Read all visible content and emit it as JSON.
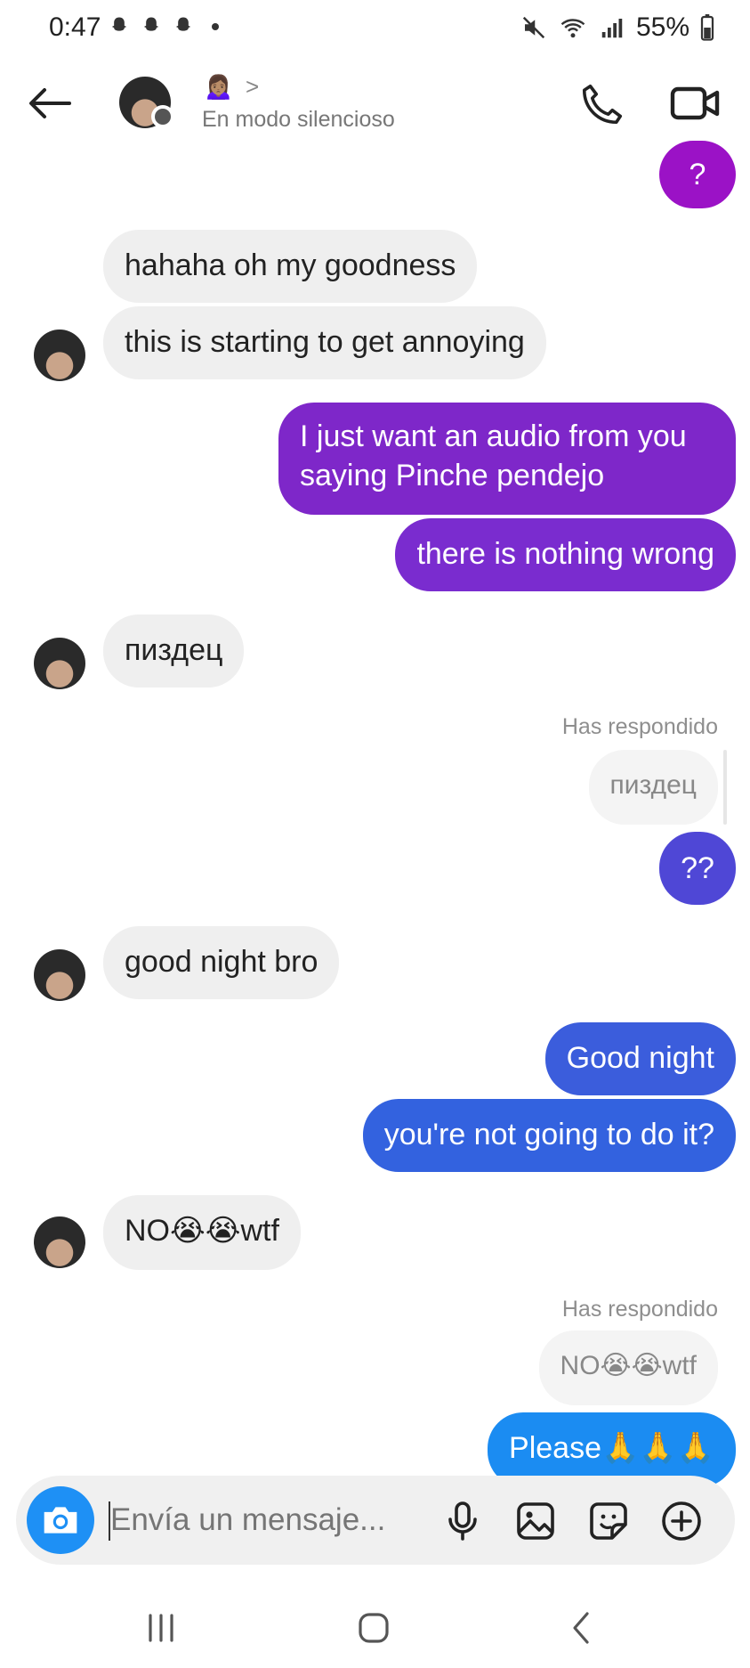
{
  "status_bar": {
    "time": "0:47",
    "battery": "55%",
    "icons": [
      "snapchat-icon",
      "snapchat-icon",
      "snapchat-icon",
      "mute-icon",
      "wifi-icon",
      "signal-icon",
      "battery-icon"
    ]
  },
  "header": {
    "contact_emoji": "🙍🏽‍♀️",
    "chevron": ">",
    "subtitle": "En modo silencioso"
  },
  "messages": [
    {
      "type": "out",
      "text": "?",
      "color": "#9b12c6"
    },
    {
      "type": "in",
      "text": "hahaha oh my goodness"
    },
    {
      "type": "in",
      "text": "this is starting to get annoying"
    },
    {
      "type": "out",
      "text": "I just want an audio from you",
      "text2": "saying Pinche pendejo",
      "color": "#7e27c9"
    },
    {
      "type": "out",
      "text": "there is nothing wrong",
      "color": "#7a2ccf"
    },
    {
      "type": "in",
      "text": "пиздец"
    },
    {
      "type": "reply_label",
      "text": "Has respondido"
    },
    {
      "type": "quoted",
      "text": "пиздец"
    },
    {
      "type": "out",
      "text": "??",
      "color": "#4f47d6"
    },
    {
      "type": "in",
      "text": "good night bro"
    },
    {
      "type": "out",
      "text": "Good night",
      "color": "#3b5ddc"
    },
    {
      "type": "out",
      "text": "you're not going to do it?",
      "color": "#3362df"
    },
    {
      "type": "in",
      "text": "NO😭😭wtf"
    },
    {
      "type": "reply_label",
      "text": "Has respondido"
    },
    {
      "type": "quoted",
      "text": "NO😭😭wtf"
    },
    {
      "type": "out",
      "text": "Please🙏🙏🙏",
      "color": "#1b8cf2"
    }
  ],
  "composer": {
    "placeholder": "Envía un mensaje..."
  }
}
